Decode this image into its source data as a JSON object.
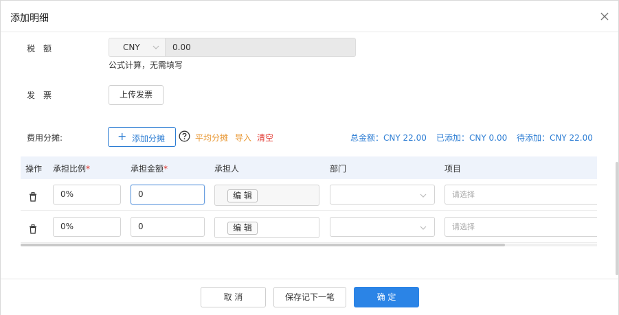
{
  "dialog": {
    "title": "添加明细"
  },
  "form": {
    "tax": {
      "label": "税　额",
      "currency": "CNY",
      "value": "0.00",
      "hint": "公式计算，无需填写"
    },
    "invoice": {
      "label": "发　票",
      "upload_label": "上传发票"
    },
    "cost_split": {
      "label": "费用分摊:",
      "add_label": "添加分摊",
      "average_label": "平均分摊",
      "import_label": "导入",
      "clear_label": "清空",
      "total": "总金额：CNY 22.00",
      "added": "已添加：CNY 0.00",
      "pending": "待添加：CNY 22.00"
    }
  },
  "table": {
    "columns": {
      "action": "操作",
      "ratio": "承担比例",
      "amount": "承担金额",
      "assignee": "承担人",
      "department": "部门",
      "project": "项目",
      "required_mark": "*"
    },
    "rows": [
      {
        "ratio": "0%",
        "amount": "0",
        "edit_label": "编 辑",
        "project_placeholder": "请选择"
      },
      {
        "ratio": "0%",
        "amount": "0",
        "edit_label": "编 辑",
        "project_placeholder": "请选择"
      }
    ]
  },
  "footer": {
    "cancel_label": "取 消",
    "save_next_label": "保存记下一笔",
    "confirm_label": "确 定"
  },
  "colors": {
    "primary": "#2b84e6",
    "link_blue": "#2b7cd3",
    "orange": "#e8952e",
    "danger": "#e0322b",
    "table_header_bg": "#eef3fb"
  },
  "icons": {
    "close": "close-icon",
    "dropdown": "chevron-down-icon",
    "help": "question-circle-icon",
    "delete": "trash-icon",
    "add": "plus-icon"
  }
}
